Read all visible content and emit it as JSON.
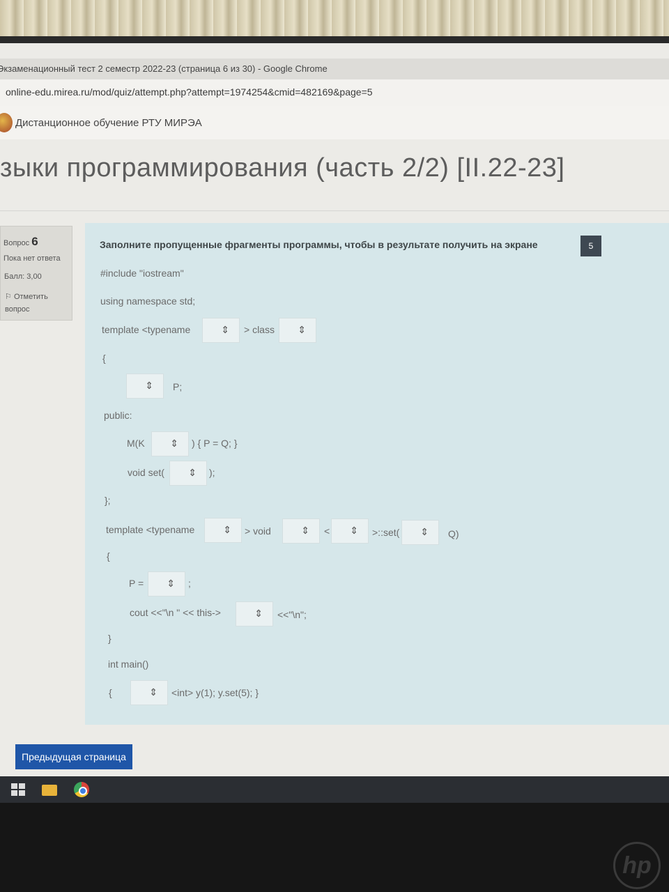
{
  "browser": {
    "window_title": "Экзаменационный тест 2 семестр 2022-23 (страница 6 из 30) - Google Chrome",
    "url": "online-edu.mirea.ru/mod/quiz/attempt.php?attempt=1974254&cmid=482169&page=5"
  },
  "site": {
    "name": "Дистанционное обучение РТУ МИРЭА"
  },
  "course": {
    "title": "зыки программирования (часть 2/2) [II.22-23]"
  },
  "question_info": {
    "label": "Вопрос",
    "number": "6",
    "state": "Пока нет ответа",
    "mark": "Балл: 3,00",
    "flag_line1": "Отметить",
    "flag_line2": "вопрос"
  },
  "question": {
    "prompt": "Заполните пропущенные фрагменты программы, чтобы в результате получить на экране",
    "output_value": "5",
    "code": {
      "l1": "#include \"iostream\"",
      "l2": "using namespace std;",
      "l3a": "template <typename",
      "l3b": "> class",
      "l4": "{",
      "l5": "P;",
      "l6": "public:",
      "l7a": "M(K",
      "l7b": ") { P = Q; }",
      "l8a": "void  set(",
      "l8b": ");",
      "l9": "};",
      "l10a": "template <typename",
      "l10b": ">  void",
      "l10c": "<",
      "l10d": ">::set(",
      "l10e": "Q)",
      "l11": "{",
      "l12a": "P =",
      "l12b": ";",
      "l13a": "cout <<\"\\n  \" << this->",
      "l13b": "<<\"\\n\";",
      "l14": "}",
      "l15": "int main()",
      "l16a": "{",
      "l16b": "<int>  y(1);   y.set(5); }"
    }
  },
  "nav": {
    "prev_label": "Предыдущая страница"
  },
  "icons": [
    "flag-icon",
    "windows-start-icon",
    "folder-icon",
    "chrome-icon",
    "hp-logo"
  ]
}
